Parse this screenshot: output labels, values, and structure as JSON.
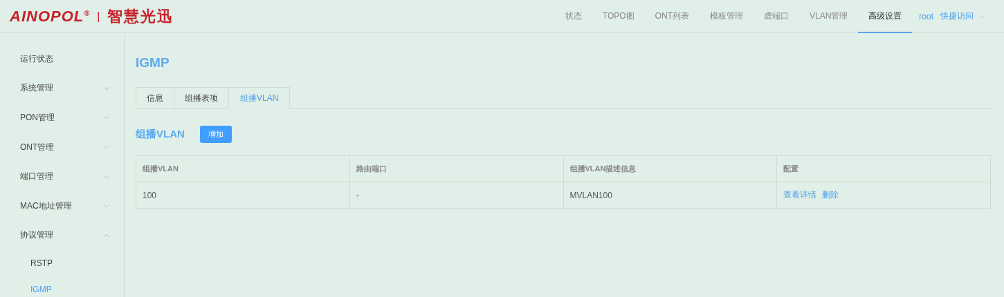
{
  "header": {
    "logo": {
      "brand": "AINOPOL$^{®}$",
      "divider": "|",
      "tagline": "智慧光迅"
    },
    "nav": [
      {
        "label": "状态",
        "selected": false
      },
      {
        "label": "TOPO图",
        "selected": false
      },
      {
        "label": "ONT列表",
        "selected": false
      },
      {
        "label": "模板管理",
        "selected": false
      },
      {
        "label": "虚端口",
        "selected": false
      },
      {
        "label": "VLAN管理",
        "selected": false
      },
      {
        "label": "高级设置",
        "selected": true
      }
    ],
    "user": "root",
    "quick_access": "快捷访问"
  },
  "sidebar": {
    "items": [
      {
        "label": "运行状态",
        "kind": "item",
        "selected": false
      },
      {
        "label": "系统管理",
        "kind": "group",
        "expanded": false
      },
      {
        "label": "PON管理",
        "kind": "group",
        "expanded": false
      },
      {
        "label": "ONT管理",
        "kind": "group",
        "expanded": false
      },
      {
        "label": "端口管理",
        "kind": "group",
        "expanded": false
      },
      {
        "label": "MAC地址管理",
        "kind": "group",
        "expanded": false
      },
      {
        "label": "协议管理",
        "kind": "group",
        "expanded": true,
        "children": [
          {
            "label": "RSTP",
            "selected": false
          },
          {
            "label": "IGMP",
            "selected": true
          }
        ]
      }
    ]
  },
  "page": {
    "title": "IGMP",
    "tabs": [
      {
        "label": "信息",
        "selected": false
      },
      {
        "label": "组播表项",
        "selected": false
      },
      {
        "label": "组播VLAN",
        "selected": true
      }
    ],
    "section_title": "组播VLAN",
    "add_button": "增加",
    "table": {
      "columns": [
        "组播VLAN",
        "路由端口",
        "组播VLAN描述信息",
        "配置"
      ],
      "rows": [
        {
          "cells": [
            "100",
            "-",
            "MVLAN100"
          ],
          "actions": [
            "查看详情",
            "删除"
          ]
        }
      ]
    }
  }
}
